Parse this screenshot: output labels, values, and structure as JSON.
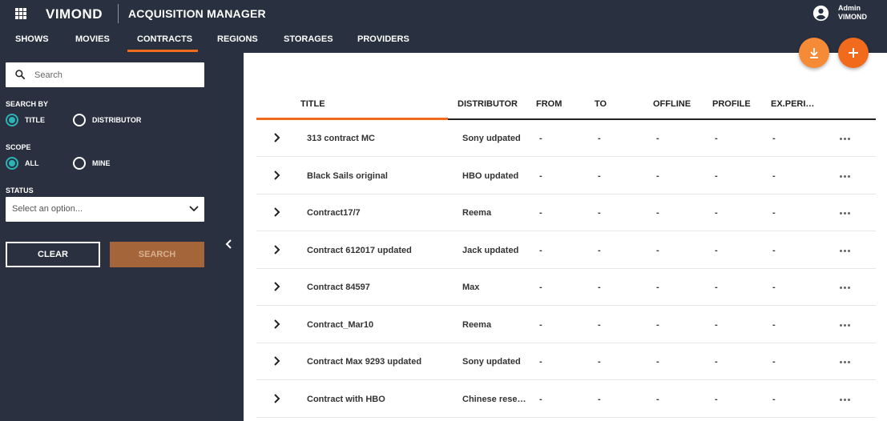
{
  "app": {
    "brand": "VIMOND",
    "title": "ACQUISITION MANAGER"
  },
  "user": {
    "role": "Admin",
    "org": "VIMOND"
  },
  "nav": {
    "items": [
      {
        "label": "SHOWS"
      },
      {
        "label": "MOVIES"
      },
      {
        "label": "CONTRACTS",
        "active": true
      },
      {
        "label": "REGIONS"
      },
      {
        "label": "STORAGES"
      },
      {
        "label": "PROVIDERS"
      }
    ]
  },
  "sidebar": {
    "search_placeholder": "Search",
    "search_by_label": "SEARCH BY",
    "search_by_options": [
      "TITLE",
      "DISTRIBUTOR"
    ],
    "search_by_selected": "TITLE",
    "scope_label": "SCOPE",
    "scope_options": [
      "ALL",
      "MINE"
    ],
    "scope_selected": "ALL",
    "status_label": "STATUS",
    "status_placeholder": "Select an option...",
    "clear_label": "CLEAR",
    "search_label": "SEARCH"
  },
  "table": {
    "columns": [
      "TITLE",
      "DISTRIBUTOR",
      "FROM",
      "TO",
      "OFFLINE",
      "PROFILE",
      "EX.PERI…"
    ],
    "rows": [
      {
        "title": "313 contract MC",
        "distributor": "Sony udpated",
        "from": "-",
        "to": "-",
        "offline": "-",
        "profile": "-",
        "ex_period": "-"
      },
      {
        "title": "Black Sails original",
        "distributor": "HBO updated",
        "from": "-",
        "to": "-",
        "offline": "-",
        "profile": "-",
        "ex_period": "-"
      },
      {
        "title": "Contract17/7",
        "distributor": "Reema",
        "from": "-",
        "to": "-",
        "offline": "-",
        "profile": "-",
        "ex_period": "-"
      },
      {
        "title": "Contract 612017 updated",
        "distributor": "Jack updated",
        "from": "-",
        "to": "-",
        "offline": "-",
        "profile": "-",
        "ex_period": "-"
      },
      {
        "title": "Contract 84597",
        "distributor": "Max",
        "from": "-",
        "to": "-",
        "offline": "-",
        "profile": "-",
        "ex_period": "-"
      },
      {
        "title": "Contract_Mar10",
        "distributor": "Reema",
        "from": "-",
        "to": "-",
        "offline": "-",
        "profile": "-",
        "ex_period": "-"
      },
      {
        "title": "Contract Max 9293 updated",
        "distributor": "Sony updated",
        "from": "-",
        "to": "-",
        "offline": "-",
        "profile": "-",
        "ex_period": "-"
      },
      {
        "title": "Contract with HBO",
        "distributor": "Chinese rese…",
        "from": "-",
        "to": "-",
        "offline": "-",
        "profile": "-",
        "ex_period": "-"
      }
    ]
  },
  "colors": {
    "header_bg": "#293040",
    "accent": "#f26b1d",
    "radio_checked": "#2bb3b6"
  },
  "icons": {
    "apps": "apps-grid-icon",
    "user": "account-circle-icon",
    "search": "search-icon",
    "dropdown": "chevron-down-icon",
    "collapse": "chevron-left-icon",
    "download": "download-icon",
    "add": "plus-icon",
    "expand": "chevron-right-icon",
    "more": "more-horizontal-icon"
  }
}
